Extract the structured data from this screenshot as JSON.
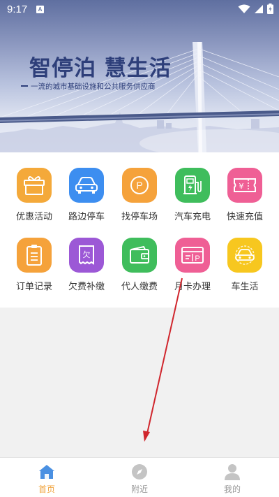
{
  "status_bar": {
    "time": "9:17",
    "notification_glyph": "A"
  },
  "banner": {
    "title": "智停泊 慧生活",
    "subtitle": "一流的城市基础设施和公共服务供应商"
  },
  "grid": {
    "items": [
      {
        "label": "优惠活动",
        "icon": "gift-icon",
        "color": "#f4a93a"
      },
      {
        "label": "路边停车",
        "icon": "car-icon",
        "color": "#3d8ef0"
      },
      {
        "label": "找停车场",
        "icon": "parking-icon",
        "color": "#f5a23b"
      },
      {
        "label": "汽车充电",
        "icon": "charging-icon",
        "color": "#3fbd5c"
      },
      {
        "label": "快速充值",
        "icon": "recharge-icon",
        "color": "#ef5f95"
      },
      {
        "label": "订单记录",
        "icon": "order-icon",
        "color": "#f5a23b"
      },
      {
        "label": "欠费补缴",
        "icon": "arrears-icon",
        "color": "#9c58d6"
      },
      {
        "label": "代人缴费",
        "icon": "wallet-icon",
        "color": "#3fbd5c"
      },
      {
        "label": "月卡办理",
        "icon": "monthly-card-icon",
        "color": "#ef5f95"
      },
      {
        "label": "车生活",
        "icon": "car-life-icon",
        "color": "#f7c71f"
      }
    ],
    "glyphs": {
      "arrears": "欠",
      "recharge": "¥",
      "parking": "P",
      "card": "P"
    }
  },
  "bottom_nav": {
    "tabs": [
      {
        "label": "首页",
        "icon": "home-icon",
        "active": true
      },
      {
        "label": "附近",
        "icon": "compass-icon",
        "active": false
      },
      {
        "label": "我的",
        "icon": "profile-icon",
        "active": false
      }
    ]
  },
  "colors": {
    "accent": "#f0a33c",
    "inactive": "#9a9a9a",
    "brand_blue": "#2e3f7a"
  }
}
